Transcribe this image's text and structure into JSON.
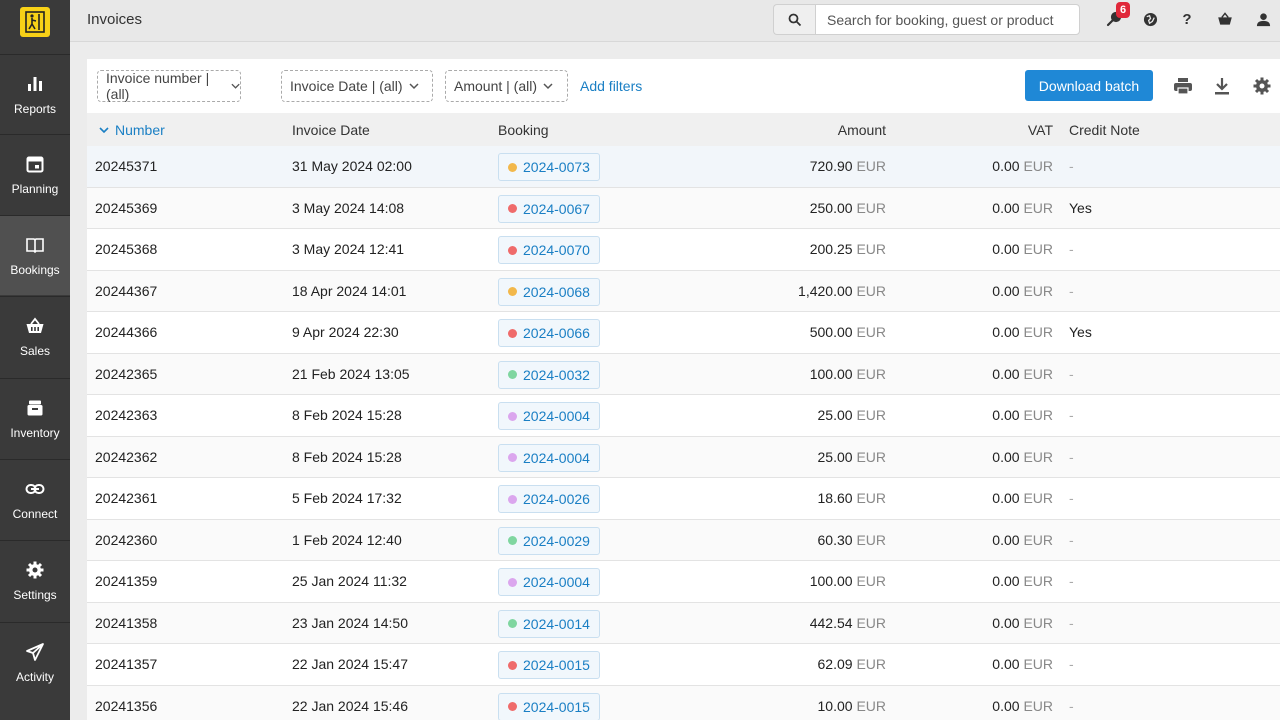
{
  "sidebar": {
    "items": [
      {
        "label": "Reports",
        "icon": "bar-chart-icon"
      },
      {
        "label": "Planning",
        "icon": "calendar-icon"
      },
      {
        "label": "Bookings",
        "icon": "book-icon"
      },
      {
        "label": "Sales",
        "icon": "basket-icon"
      },
      {
        "label": "Inventory",
        "icon": "archive-icon"
      },
      {
        "label": "Connect",
        "icon": "link-icon"
      },
      {
        "label": "Settings",
        "icon": "gear-icon"
      },
      {
        "label": "Activity",
        "icon": "paper-plane-icon"
      }
    ],
    "active": "Bookings"
  },
  "header": {
    "title": "Invoices",
    "search_placeholder": "Search for booking, guest or product",
    "notification_count": "6"
  },
  "filters": {
    "invoice_number": "Invoice number | (all)",
    "invoice_date": "Invoice Date | (all)",
    "amount": "Amount | (all)",
    "add_filters": "Add filters",
    "download_batch": "Download batch"
  },
  "table": {
    "columns": {
      "number": "Number",
      "date": "Invoice Date",
      "booking": "Booking",
      "amount": "Amount",
      "vat": "VAT",
      "credit": "Credit Note"
    },
    "currency": "EUR",
    "rows": [
      {
        "number": "20245371",
        "date": "31 May 2024 02:00",
        "booking": "2024-0073",
        "dot": "#f2b84b",
        "amount": "720.90",
        "vat": "0.00",
        "credit": "-"
      },
      {
        "number": "20245369",
        "date": "3 May 2024 14:08",
        "booking": "2024-0067",
        "dot": "#ef6b6b",
        "amount": "250.00",
        "vat": "0.00",
        "credit": "Yes"
      },
      {
        "number": "20245368",
        "date": "3 May 2024 12:41",
        "booking": "2024-0070",
        "dot": "#ef6b6b",
        "amount": "200.25",
        "vat": "0.00",
        "credit": "-"
      },
      {
        "number": "20244367",
        "date": "18 Apr 2024 14:01",
        "booking": "2024-0068",
        "dot": "#f2b84b",
        "amount": "1,420.00",
        "vat": "0.00",
        "credit": "-"
      },
      {
        "number": "20244366",
        "date": "9 Apr 2024 22:30",
        "booking": "2024-0066",
        "dot": "#ef6b6b",
        "amount": "500.00",
        "vat": "0.00",
        "credit": "Yes"
      },
      {
        "number": "20242365",
        "date": "21 Feb 2024 13:05",
        "booking": "2024-0032",
        "dot": "#7fd6a0",
        "amount": "100.00",
        "vat": "0.00",
        "credit": "-"
      },
      {
        "number": "20242363",
        "date": "8 Feb 2024 15:28",
        "booking": "2024-0004",
        "dot": "#dba6ee",
        "amount": "25.00",
        "vat": "0.00",
        "credit": "-"
      },
      {
        "number": "20242362",
        "date": "8 Feb 2024 15:28",
        "booking": "2024-0004",
        "dot": "#dba6ee",
        "amount": "25.00",
        "vat": "0.00",
        "credit": "-"
      },
      {
        "number": "20242361",
        "date": "5 Feb 2024 17:32",
        "booking": "2024-0026",
        "dot": "#dba6ee",
        "amount": "18.60",
        "vat": "0.00",
        "credit": "-"
      },
      {
        "number": "20242360",
        "date": "1 Feb 2024 12:40",
        "booking": "2024-0029",
        "dot": "#7fd6a0",
        "amount": "60.30",
        "vat": "0.00",
        "credit": "-"
      },
      {
        "number": "20241359",
        "date": "25 Jan 2024 11:32",
        "booking": "2024-0004",
        "dot": "#dba6ee",
        "amount": "100.00",
        "vat": "0.00",
        "credit": "-"
      },
      {
        "number": "20241358",
        "date": "23 Jan 2024 14:50",
        "booking": "2024-0014",
        "dot": "#7fd6a0",
        "amount": "442.54",
        "vat": "0.00",
        "credit": "-"
      },
      {
        "number": "20241357",
        "date": "22 Jan 2024 15:47",
        "booking": "2024-0015",
        "dot": "#ef6b6b",
        "amount": "62.09",
        "vat": "0.00",
        "credit": "-"
      },
      {
        "number": "20241356",
        "date": "22 Jan 2024 15:46",
        "booking": "2024-0015",
        "dot": "#ef6b6b",
        "amount": "10.00",
        "vat": "0.00",
        "credit": "-"
      }
    ]
  },
  "colors": {
    "accent": "#1f88d6",
    "sidebar": "#3a3a3a",
    "logo": "#f7d117",
    "badge": "#e0283a"
  }
}
